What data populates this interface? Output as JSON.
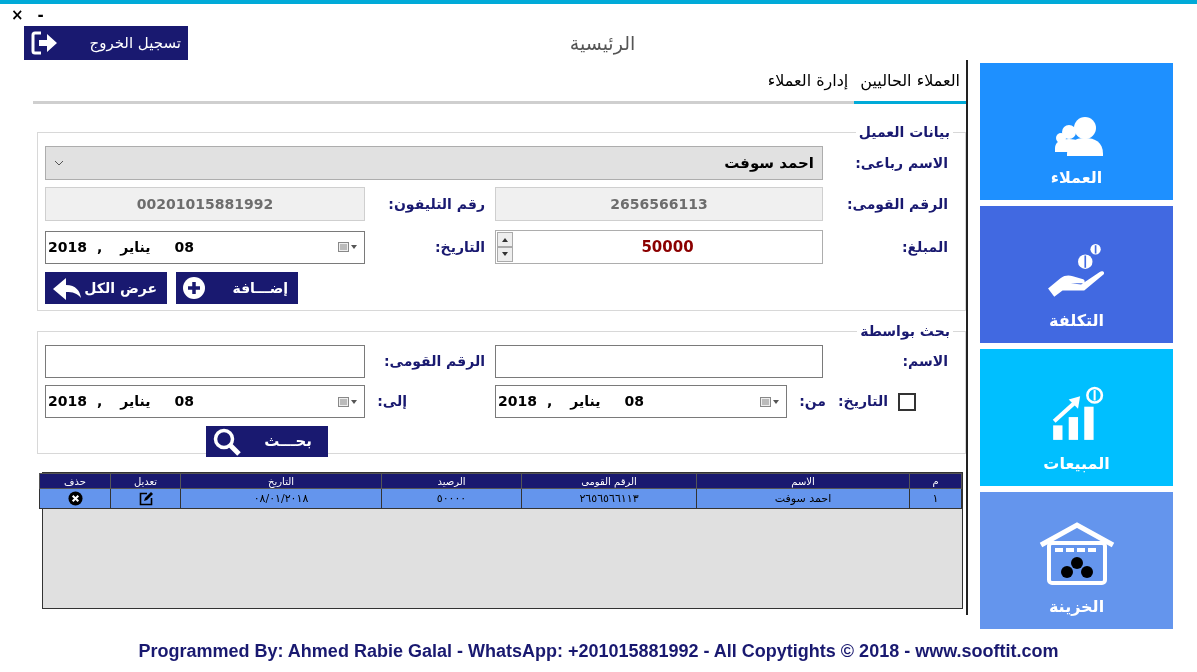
{
  "window": {
    "controls": [
      "-",
      "×"
    ],
    "title": "الرئيسية"
  },
  "logout_button": "تسجيل الخروج",
  "tabs": [
    {
      "label": "العملاء الحاليين",
      "selected": true
    },
    {
      "label": "إدارة العملاء",
      "selected": false
    }
  ],
  "customer_data": {
    "legend": "بيانات العميل",
    "full_name": {
      "label": "الاسم رباعى:",
      "value": "احمد سوفت"
    },
    "national_id": {
      "label": "الرقم القومى:",
      "value": "2656566113"
    },
    "phone": {
      "label": "رقم التليفون:",
      "value": "00201015881992"
    },
    "amount": {
      "label": "المبلغ:",
      "value": "50000"
    },
    "date": {
      "label": "التاريخ:",
      "day": "08",
      "month": "يناير",
      "separator": ",",
      "year": "2018"
    },
    "buttons": [
      {
        "label": "إضـــافة",
        "kind": "add"
      },
      {
        "label": "عرض الكل",
        "kind": "back"
      }
    ]
  },
  "search": {
    "legend": "بحث بواسطة",
    "name": {
      "label": "الاسم:"
    },
    "national_id": {
      "label": "الرقم القومى:"
    },
    "date_filter": {
      "label": "التاريخ:",
      "checked": false
    },
    "from": {
      "label": "من:",
      "day": "08",
      "month": "يناير",
      "separator": ",",
      "year": "2018"
    },
    "to": {
      "label": "إلى:",
      "day": "08",
      "month": "يناير",
      "separator": ",",
      "year": "2018"
    },
    "button": "بحـــث"
  },
  "table": {
    "columns": [
      "م",
      "الاسم",
      "الرقم القومى",
      "الرصيد",
      "التاريخ",
      "تعديل",
      "حذف"
    ],
    "rows": [
      {
        "selected": true,
        "cells": [
          "١",
          "احمد سوفت",
          "٢٦٥٦٥٦٦١١٣",
          "٥٠٠٠٠",
          "٠٨/٠١/٢٠١٨"
        ]
      }
    ]
  },
  "sidebar": {
    "items": [
      {
        "label": "العملاء",
        "kind": "customers",
        "color": "#1e90ff"
      },
      {
        "label": "التكلفة",
        "kind": "cost",
        "color": "#4169e1"
      },
      {
        "label": "المبيعات",
        "kind": "sales",
        "color": "#00bfff"
      },
      {
        "label": "الخزينة",
        "kind": "treasury",
        "color": "#6495ed"
      }
    ]
  },
  "footer": "Programmed By: Ahmed Rabie Galal - WhatsApp: +201015881992 - All Copytights © 2018 - www.sooftit.com"
}
